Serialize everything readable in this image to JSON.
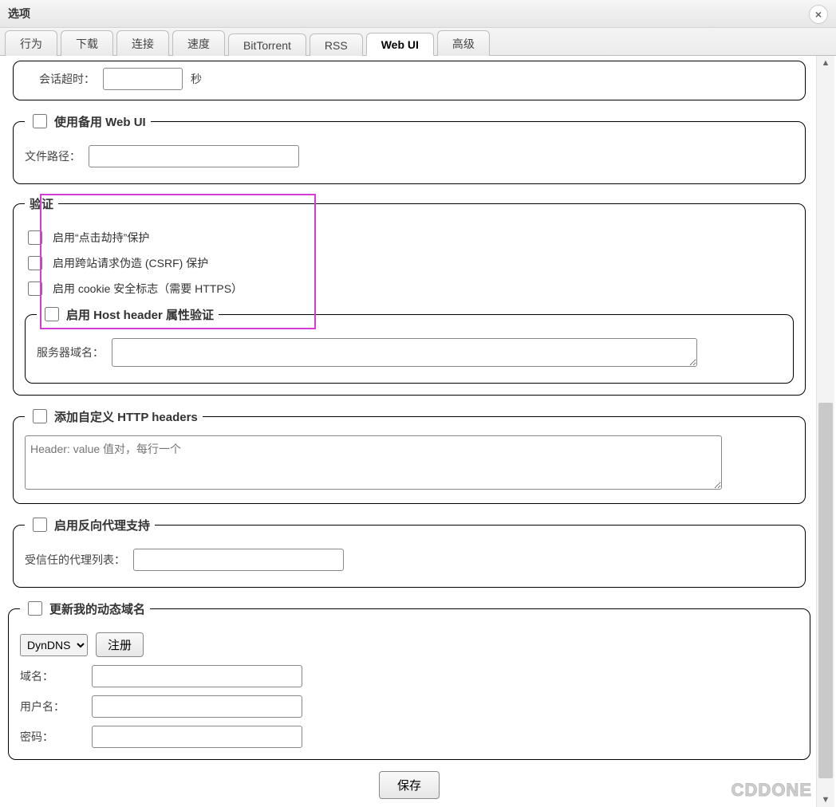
{
  "dialog": {
    "title": "选项",
    "close_icon": "×"
  },
  "tabs": {
    "items": [
      {
        "label": "行为"
      },
      {
        "label": "下载"
      },
      {
        "label": "连接"
      },
      {
        "label": "速度"
      },
      {
        "label": "BitTorrent"
      },
      {
        "label": "RSS"
      },
      {
        "label": "Web UI"
      },
      {
        "label": "高级"
      }
    ],
    "active_index": 6
  },
  "session": {
    "timeout_label": "会话超时：",
    "timeout_value": "",
    "timeout_unit": "秒"
  },
  "alt_webui": {
    "legend": "使用备用 Web UI",
    "checked": false,
    "file_path_label": "文件路径：",
    "file_path_value": ""
  },
  "auth": {
    "legend": "验证",
    "clickjacking": {
      "checked": false,
      "label": "启用“点击劫持”保护"
    },
    "csrf": {
      "checked": false,
      "label": "启用跨站请求伪造 (CSRF) 保护"
    },
    "cookie_secure": {
      "checked": false,
      "label": "启用 cookie 安全标志（需要 HTTPS）"
    },
    "host_header": {
      "checked": false,
      "legend": "启用 Host header 属性验证",
      "server_domain_label": "服务器域名：",
      "server_domain_value": ""
    }
  },
  "custom_headers": {
    "legend": "添加自定义 HTTP headers",
    "checked": false,
    "placeholder": "Header: value 值对，每行一个",
    "value": ""
  },
  "reverse_proxy": {
    "legend": "启用反向代理支持",
    "checked": false,
    "trusted_list_label": "受信任的代理列表：",
    "trusted_list_value": ""
  },
  "dyndns": {
    "legend": "更新我的动态域名",
    "checked": false,
    "service_selected": "DynDNS",
    "service_options": [
      "DynDNS"
    ],
    "register_label": "注册",
    "domain_label": "域名：",
    "domain_value": "",
    "username_label": "用户名：",
    "username_value": "",
    "password_label": "密码：",
    "password_value": ""
  },
  "save_button": "保存",
  "watermark": "CDDONE"
}
